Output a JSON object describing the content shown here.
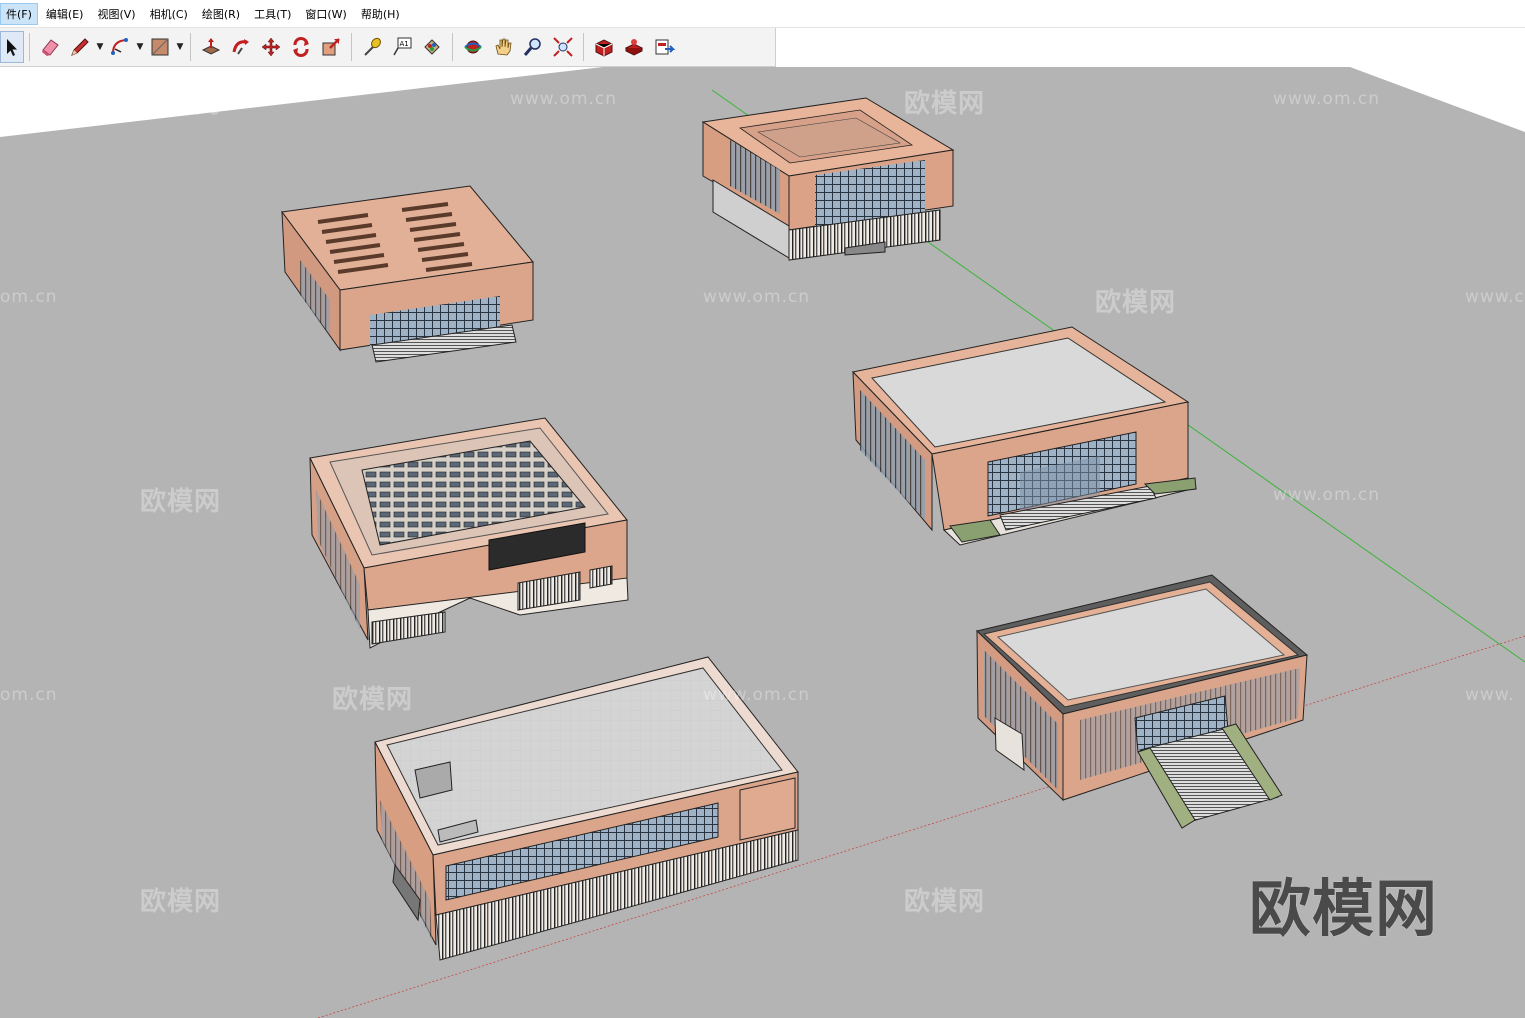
{
  "menu": {
    "items": [
      {
        "label": "件(F)",
        "active": true
      },
      {
        "label": "编辑(E)"
      },
      {
        "label": "视图(V)"
      },
      {
        "label": "相机(C)"
      },
      {
        "label": "绘图(R)"
      },
      {
        "label": "工具(T)"
      },
      {
        "label": "窗口(W)"
      },
      {
        "label": "帮助(H)"
      }
    ]
  },
  "toolbar": {
    "tools": [
      "select-tool-icon",
      "eraser-tool-icon",
      "pencil-line-tool-icon",
      "arc-tool-icon",
      "rectangle-tool-icon",
      "push-pull-tool-icon",
      "follow-me-tool-icon",
      "move-tool-icon",
      "rotate-tool-icon",
      "scale-tool-icon",
      "tape-measure-tool-icon",
      "text-tool-icon",
      "paint-bucket-tool-icon",
      "orbit-tool-icon",
      "pan-tool-icon",
      "zoom-tool-icon",
      "zoom-extents-tool-icon",
      "3d-warehouse-icon",
      "extension-warehouse-icon",
      "send-to-layout-icon"
    ],
    "text_tool_glyph": "A1"
  },
  "watermarks": {
    "brand": "欧模网",
    "url": "www.om.cn",
    "url_partial": "om.cn",
    "url_partial_right": "www.c",
    "url_partial_right2": "www.",
    "big": "欧模网"
  },
  "colors": {
    "ground": "#b4b4b4",
    "sky": "#ffffff",
    "brick": "#d9a48a",
    "roof": "#d6d6d6",
    "green_axis": "#3cb43c",
    "red_axis": "#c84646"
  }
}
